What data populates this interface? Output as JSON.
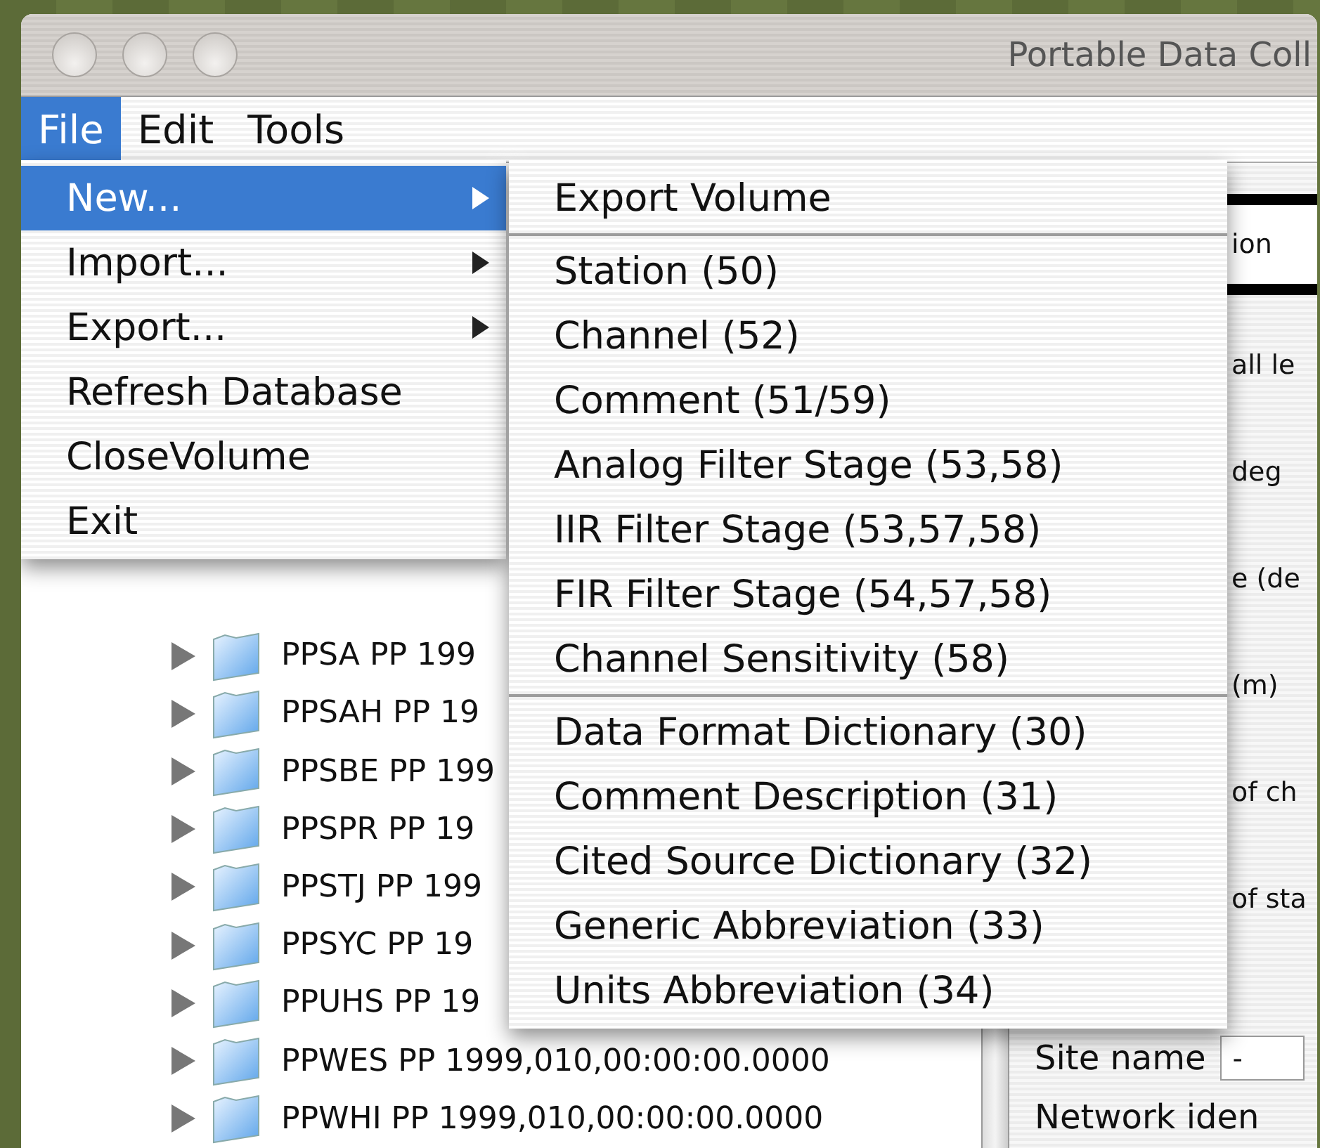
{
  "window": {
    "title": "Portable Data Coll"
  },
  "menubar": [
    {
      "label": "File",
      "selected": true
    },
    {
      "label": "Edit",
      "selected": false
    },
    {
      "label": "Tools",
      "selected": false
    }
  ],
  "file_menu": [
    {
      "label": "New...",
      "selected": true,
      "has_submenu": true
    },
    {
      "label": "Import...",
      "selected": false,
      "has_submenu": true
    },
    {
      "label": "Export...",
      "selected": false,
      "has_submenu": true
    },
    {
      "label": "Refresh Database",
      "selected": false,
      "has_submenu": false
    },
    {
      "label": "CloseVolume",
      "selected": false,
      "has_submenu": false
    },
    {
      "label": "Exit",
      "selected": false,
      "has_submenu": false
    }
  ],
  "new_submenu": [
    [
      {
        "label": "Export Volume"
      }
    ],
    [
      {
        "label": "Station (50)"
      },
      {
        "label": "Channel (52)"
      },
      {
        "label": "Comment (51/59)"
      },
      {
        "label": "Analog Filter Stage (53,58)"
      },
      {
        "label": "IIR Filter Stage (53,57,58)"
      },
      {
        "label": "FIR Filter Stage (54,57,58)"
      },
      {
        "label": "Channel Sensitivity (58)"
      }
    ],
    [
      {
        "label": "Data Format Dictionary (30)"
      },
      {
        "label": "Comment Description (31)"
      },
      {
        "label": "Cited Source Dictionary (32)"
      },
      {
        "label": "Generic Abbreviation (33)"
      },
      {
        "label": "Units Abbreviation (34)"
      }
    ]
  ],
  "tree": [
    {
      "label": "PPSA PP 199",
      "expanded": false
    },
    {
      "label": "PPSAH PP 19",
      "expanded": false
    },
    {
      "label": "PPSBE PP 199",
      "expanded": false
    },
    {
      "label": "PPSPR PP 19",
      "expanded": false
    },
    {
      "label": "PPSTJ PP 199",
      "expanded": false
    },
    {
      "label": "PPSYC PP 19",
      "expanded": false
    },
    {
      "label": "PPUHS PP 19",
      "expanded": false
    },
    {
      "label": "PPWES PP 1999,010,00:00:00.0000",
      "expanded": false
    },
    {
      "label": "PPWHI PP 1999,010,00:00:00.0000",
      "expanded": false
    }
  ],
  "detail_panel": {
    "header": "ion",
    "fields": [
      {
        "label": "all le"
      },
      {
        "label": "deg"
      },
      {
        "label": "e (de"
      },
      {
        "label": "(m)"
      },
      {
        "label": "of ch"
      },
      {
        "label": "of sta"
      }
    ],
    "site_name": {
      "label": "Site name",
      "value": "-"
    },
    "network_identifier": {
      "label": "Network iden"
    }
  }
}
